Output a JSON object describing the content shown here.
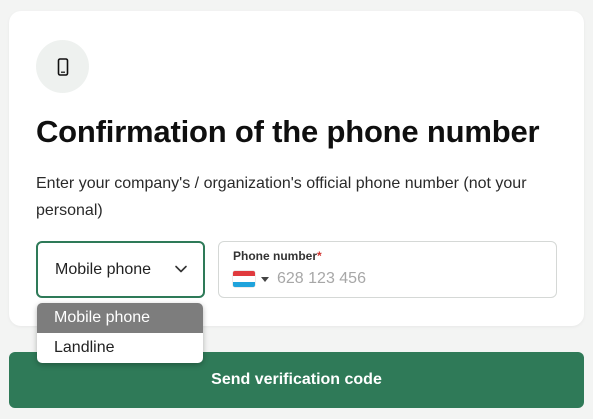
{
  "header": {
    "icon": "mobile-phone-icon",
    "title": "Confirmation of the phone number",
    "subtitle": "Enter your company's / organization's official phone number (not your personal)"
  },
  "phone_type": {
    "selected": "Mobile phone",
    "options": [
      "Mobile phone",
      "Landline"
    ]
  },
  "phone": {
    "label": "Phone number",
    "required_marker": "*",
    "placeholder": "628 123 456",
    "value": "",
    "country_flag": "luxembourg-flag-icon"
  },
  "actions": {
    "send_label": "Send verification code"
  },
  "colors": {
    "accent": "#2f7a58",
    "selected_option_bg": "#7d7d7d",
    "required": "#d0312d"
  }
}
